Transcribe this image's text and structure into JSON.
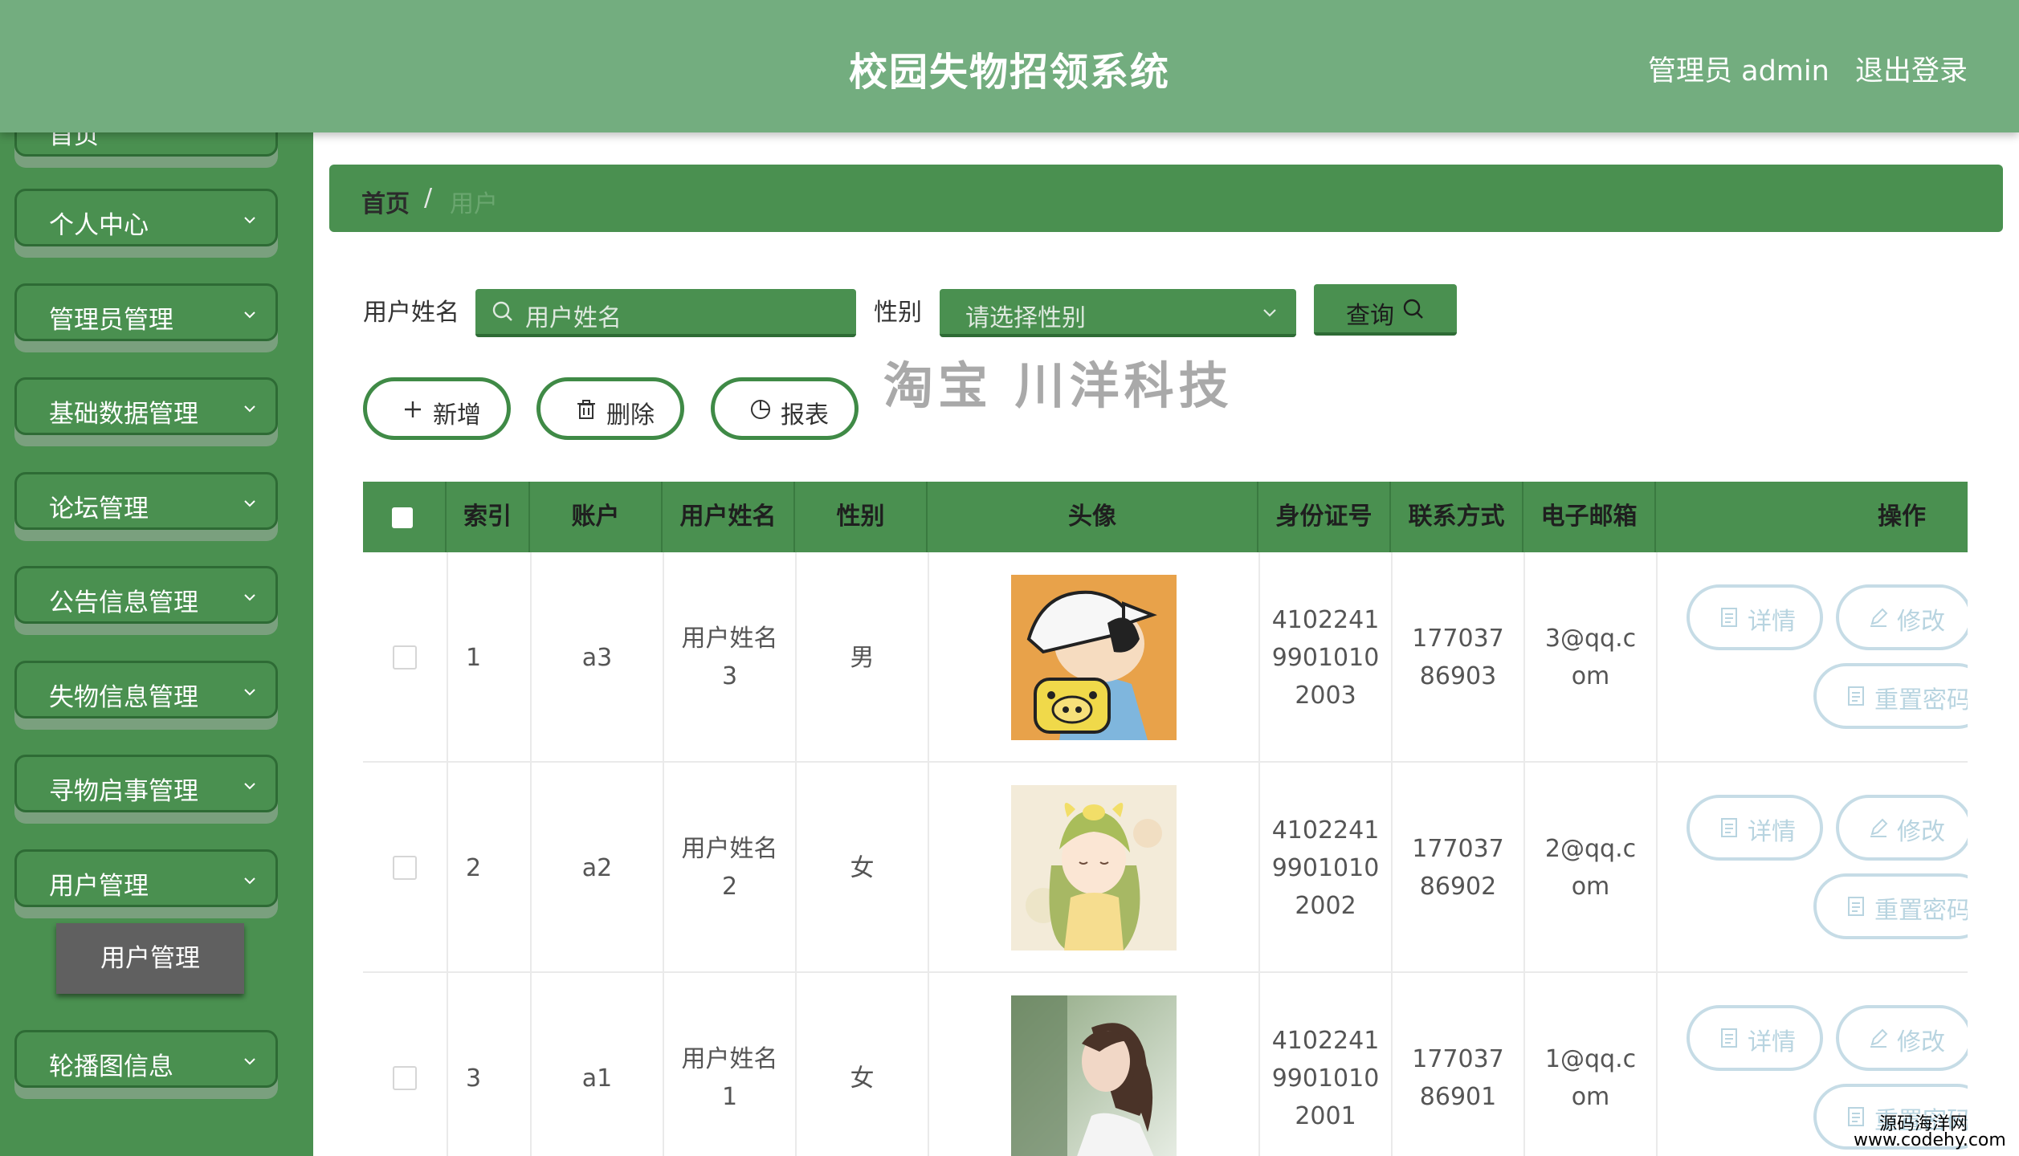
{
  "header": {
    "title": "校园失物招领系统",
    "admin_label": "管理员 admin",
    "logout_label": "退出登录"
  },
  "sidebar": {
    "items": [
      {
        "label": "首页"
      },
      {
        "label": "个人中心"
      },
      {
        "label": "管理员管理"
      },
      {
        "label": "基础数据管理"
      },
      {
        "label": "论坛管理"
      },
      {
        "label": "公告信息管理"
      },
      {
        "label": "失物信息管理"
      },
      {
        "label": "寻物启事管理"
      },
      {
        "label": "用户管理"
      },
      {
        "label": "轮播图信息"
      }
    ],
    "active_sub": "用户管理"
  },
  "breadcrumb": {
    "home": "首页",
    "separator": "/",
    "current": "用户"
  },
  "search": {
    "name_label": "用户姓名",
    "name_placeholder": "用户姓名",
    "gender_label": "性别",
    "gender_placeholder": "请选择性别",
    "query_label": "查询"
  },
  "watermark": "淘宝 川洋科技",
  "actions": {
    "add": "新增",
    "delete": "删除",
    "report": "报表"
  },
  "table": {
    "headers": [
      "索引",
      "账户",
      "用户姓名",
      "性别",
      "头像",
      "身份证号",
      "联系方式",
      "电子邮箱",
      "操作"
    ],
    "rows": [
      {
        "index": "1",
        "account": "a3",
        "name": "用户姓名3",
        "gender": "男",
        "id": "410224199010102003",
        "phone": "17703786903",
        "email": "3@qq.com",
        "avatar": "cartoon-boy-avatar"
      },
      {
        "index": "2",
        "account": "a2",
        "name": "用户姓名2",
        "gender": "女",
        "id": "410224199010102002",
        "phone": "17703786902",
        "email": "2@qq.com",
        "avatar": "illustrated-girl-avatar"
      },
      {
        "index": "3",
        "account": "a1",
        "name": "用户姓名1",
        "gender": "女",
        "id": "410224199010102001",
        "phone": "17703786901",
        "email": "1@qq.com",
        "avatar": "photo-girl-avatar"
      }
    ],
    "ops": {
      "detail": "详情",
      "edit": "修改",
      "reset": "重置密码"
    }
  },
  "site_watermark": {
    "line1": "源码海洋网",
    "line2": "www.codehy.com"
  },
  "colors": {
    "header": "#73ad7f",
    "sidebar": "#4a9050",
    "accent": "#3f8a46"
  }
}
